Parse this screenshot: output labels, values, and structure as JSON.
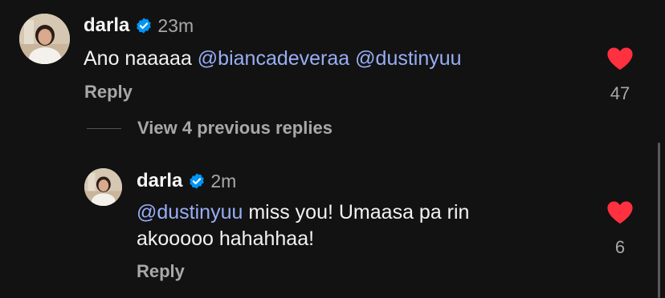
{
  "comment": {
    "username": "darla",
    "time": "23m",
    "text_prefix": "Ano naaaaa ",
    "mention1": "@biancadeveraa",
    "mention2": "@dustinyuu",
    "reply_label": "Reply",
    "likes": "47",
    "heart_icon": "heart-icon",
    "verified_icon": "verified-badge-icon",
    "heart_color": "#ff3040",
    "verified_color": "#0095f6"
  },
  "view_replies_label": "View 4 previous replies",
  "reply": {
    "username": "darla",
    "time": "2m",
    "mention": "@dustinyuu",
    "text_line1": " miss you! Umaasa pa rin",
    "text_line2": "akooooo hahahhaa!",
    "reply_label": "Reply",
    "likes": "6"
  },
  "colors": {
    "background": "#121212",
    "mention": "#98aef5",
    "secondary_text": "#a8a8a8"
  }
}
